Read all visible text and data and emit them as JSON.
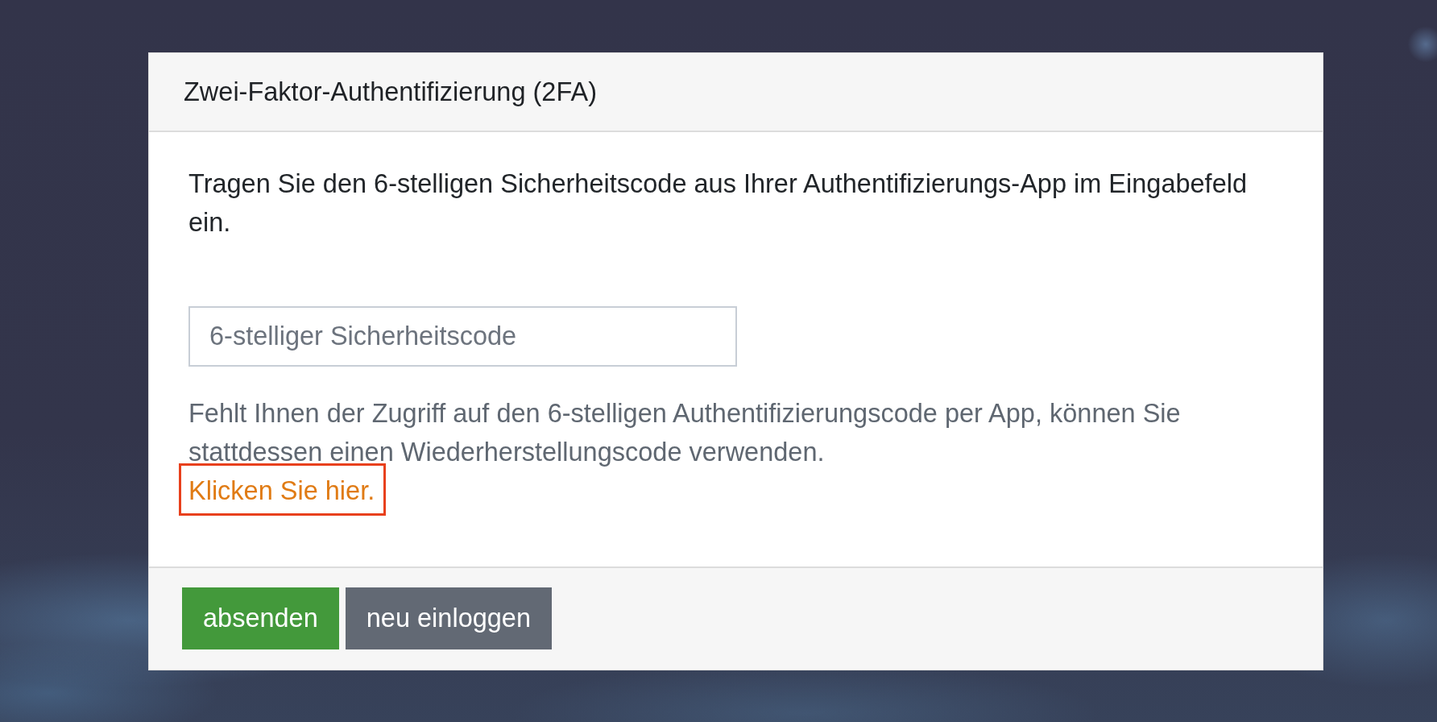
{
  "dialog": {
    "title": "Zwei-Faktor-Authentifizierung (2FA)"
  },
  "instructions": "Tragen Sie den 6-stelligen Sicherheitscode aus Ihrer Authentifizierungs-App im Eingabefeld ein.",
  "code_field": {
    "placeholder": "6-stelliger Sicherheitscode"
  },
  "recovery": {
    "text": "Fehlt Ihnen der Zugriff auf den 6-stelligen Authentifizierungscode per App, können Sie stattdessen einen Wiederherstellungscode verwenden.",
    "link": "Klicken Sie hier.",
    "highlighted": true
  },
  "buttons": [
    {
      "label": "absenden",
      "kind": "primary"
    },
    {
      "label": "neu einloggen",
      "kind": "secondary"
    }
  ]
}
